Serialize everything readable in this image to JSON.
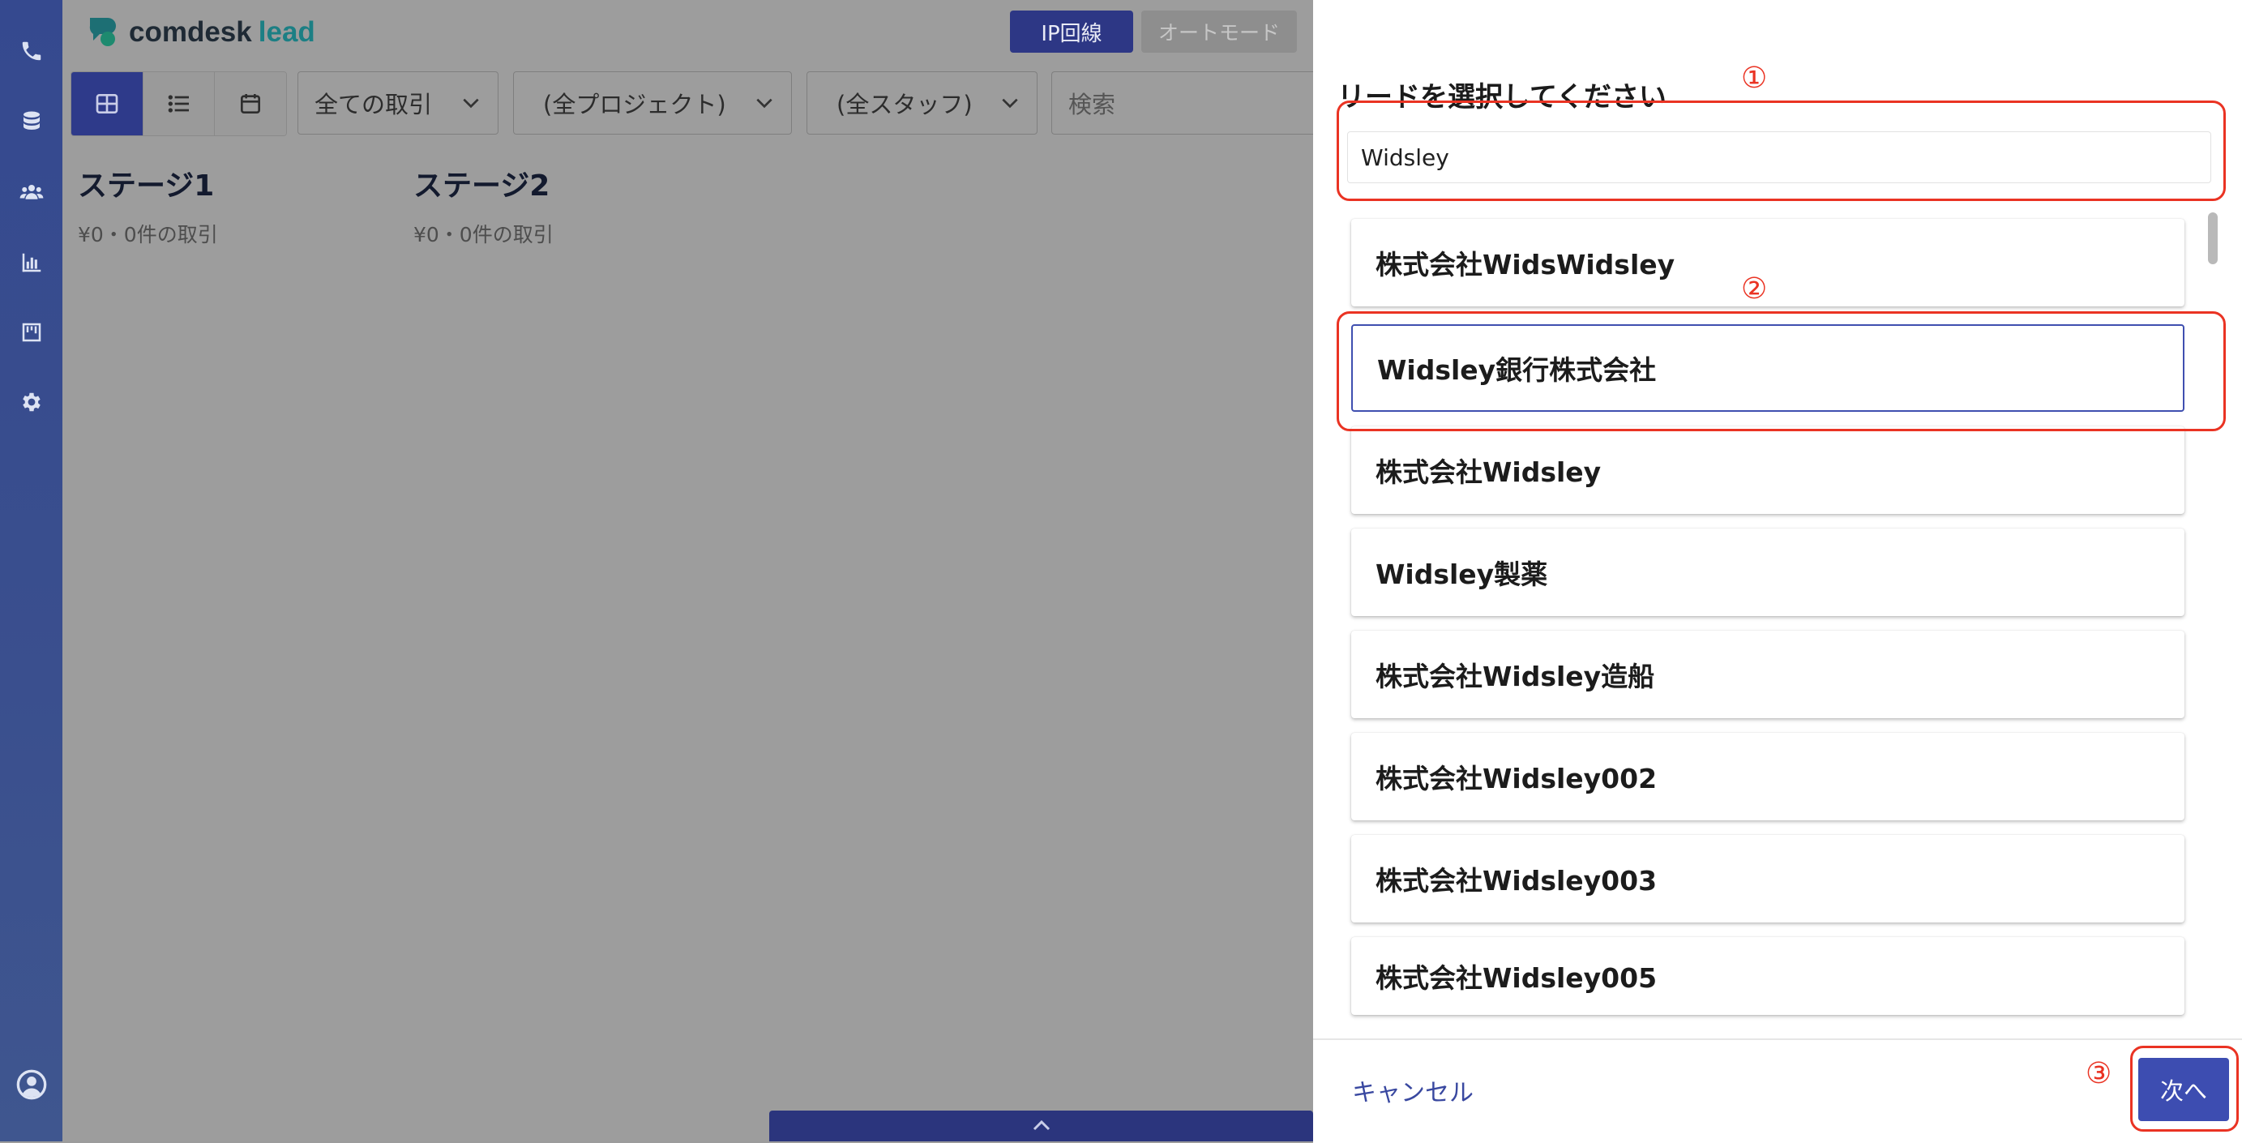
{
  "app": {
    "brand_main": "comdesk",
    "brand_sub": "lead",
    "ip_button": "IP回線",
    "auto_mode_button": "オートモード",
    "filters": {
      "deals": "全ての取引",
      "projects": "(全プロジェクト)",
      "staff": "(全スタッフ)"
    },
    "search_placeholder": "検索",
    "stages": [
      {
        "name": "ステージ1",
        "meta": "¥0・0件の取引"
      },
      {
        "name": "ステージ2",
        "meta": "¥0・0件の取引"
      }
    ],
    "sidebar_icons": [
      "phone-icon",
      "database-icon",
      "users-icon",
      "chart-icon",
      "board-icon",
      "gear-icon",
      "account-icon"
    ]
  },
  "panel": {
    "title": "リードを選択してください",
    "search_value": "Widsley",
    "items": [
      "株式会社WidsWidsley",
      "Widsley銀行株式会社",
      "株式会社Widsley",
      "Widsley製薬",
      "株式会社Widsley造船",
      "株式会社Widsley002",
      "株式会社Widsley003",
      "株式会社Widsley005"
    ],
    "selected_index": 1,
    "cancel_label": "キャンセル",
    "next_label": "次へ"
  },
  "annotations": {
    "step1": "①",
    "step2": "②",
    "step3": "③",
    "color": "#ea3323"
  }
}
